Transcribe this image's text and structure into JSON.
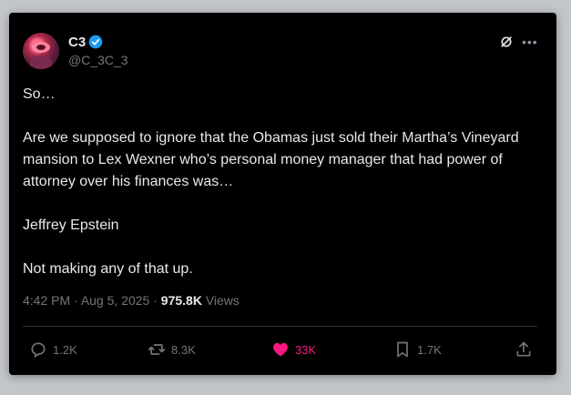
{
  "author": {
    "name": "C3",
    "handle": "@C_3C_3"
  },
  "tweet": {
    "lines": [
      "So…",
      "Are we supposed to ignore that the Obamas just sold their Martha’s Vineyard mansion to Lex Wexner who’s personal money manager that had power of attorney over his finances was…",
      "Jeffrey Epstein",
      "Not making any of that up."
    ]
  },
  "meta": {
    "time": "4:42 PM",
    "date": "Aug 5, 2025",
    "views_count": "975.8K",
    "views_label": "Views"
  },
  "actions": {
    "reply": "1.2K",
    "retweet": "8.3K",
    "like": "33K",
    "bookmark": "1.7K"
  },
  "colors": {
    "background": "#000000",
    "text": "#e7e9ea",
    "muted": "#71767b",
    "verified": "#1d9bf0",
    "like": "#f91880"
  }
}
